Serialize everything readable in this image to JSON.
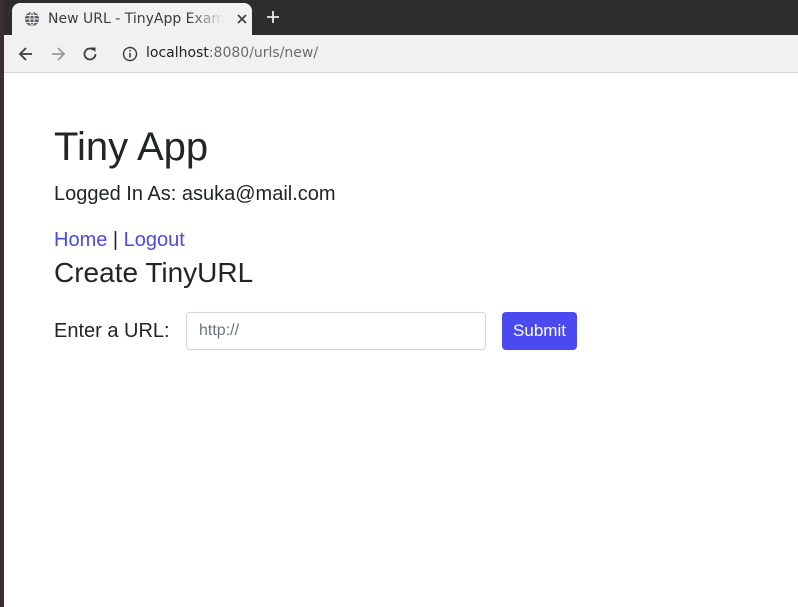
{
  "browser": {
    "tab": {
      "title": "New URL - TinyApp Example App",
      "icon": "globe-icon"
    },
    "address": {
      "host": "localhost",
      "rest": ":8080/urls/new/"
    }
  },
  "header": {
    "app_title": "Tiny App",
    "logged_in_text": "Logged In As: asuka@mail.com"
  },
  "nav": {
    "home_label": "Home",
    "separator": " | ",
    "logout_label": "Logout"
  },
  "form": {
    "heading": "Create TinyURL",
    "url_label": "Enter a URL:",
    "url_placeholder": "http://",
    "submit_label": "Submit"
  },
  "colors": {
    "link": "#4a4ae6",
    "submit_bg": "#4a4af0",
    "text": "#212529"
  }
}
